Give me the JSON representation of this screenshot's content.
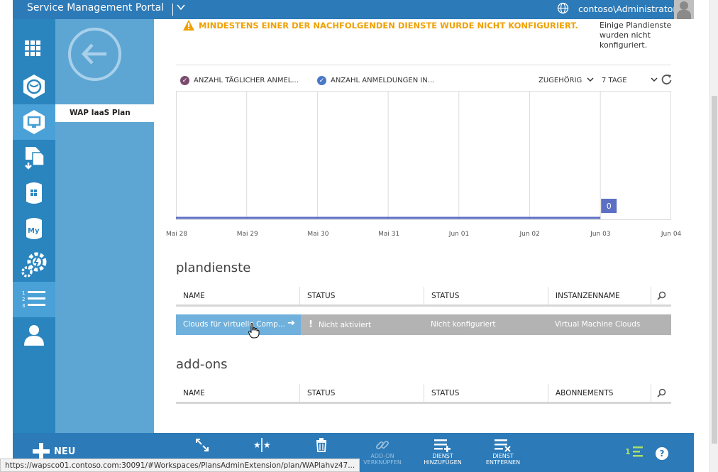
{
  "topbar": {
    "title": "Service Management Portal",
    "user": "contoso\\Administrator"
  },
  "nav": {
    "plan_item": "WAP IaaS Plan"
  },
  "warning": {
    "text": "MINDESTENS EINER DER NACHFOLGENDEN DIENSTE WURDE NICHT KONFIGURIERT.",
    "side": "Einige Plandienste wurden nicht konfiguriert."
  },
  "chart_controls": {
    "legend1": "ANZAHL TÄGLICHER ANMEL...",
    "legend2": "ANZAHL ANMELDUNGEN IN...",
    "scope": "ZUGEHÖRIG",
    "range": "7 TAGE"
  },
  "chart_data": {
    "type": "line",
    "x": [
      "Mai 28",
      "Mai 29",
      "Mai 30",
      "Mai 31",
      "Jun 01",
      "Jun 02",
      "Jun 03",
      "Jun 04"
    ],
    "series": [
      {
        "name": "ANZAHL TÄGLICHER ANMEL...",
        "values": [
          0,
          0,
          0,
          0,
          0,
          0,
          0
        ]
      }
    ],
    "last_label": "0",
    "colors": {
      "line": "#5d6fc4",
      "grid": "#dddddd"
    }
  },
  "plandienste": {
    "title": "plandienste",
    "headers": [
      "NAME",
      "STATUS",
      "STATUS",
      "INSTANZENNAME"
    ],
    "row": {
      "name": "Clouds für virtuelle Comp...",
      "status1": "Nicht aktiviert",
      "status2": "Nicht konfiguriert",
      "instance": "Virtual Machine Clouds"
    }
  },
  "addons": {
    "title": "add-ons",
    "headers": [
      "NAME",
      "STATUS",
      "STATUS",
      "ABONNEMENTS"
    ]
  },
  "cmdbar": {
    "new": "NEU",
    "cmd_addon": "ADD-ON VERKNÜPFEN",
    "cmd_add": "DIENST HINZUFÜGEN",
    "cmd_remove": "DIENST ENTFERNEN",
    "counter": "1"
  },
  "statusbar": {
    "url": "https://wapsco01.contoso.com:30091/#Workspaces/PlansAdminExtension/plan/WAPlahvz47..."
  }
}
